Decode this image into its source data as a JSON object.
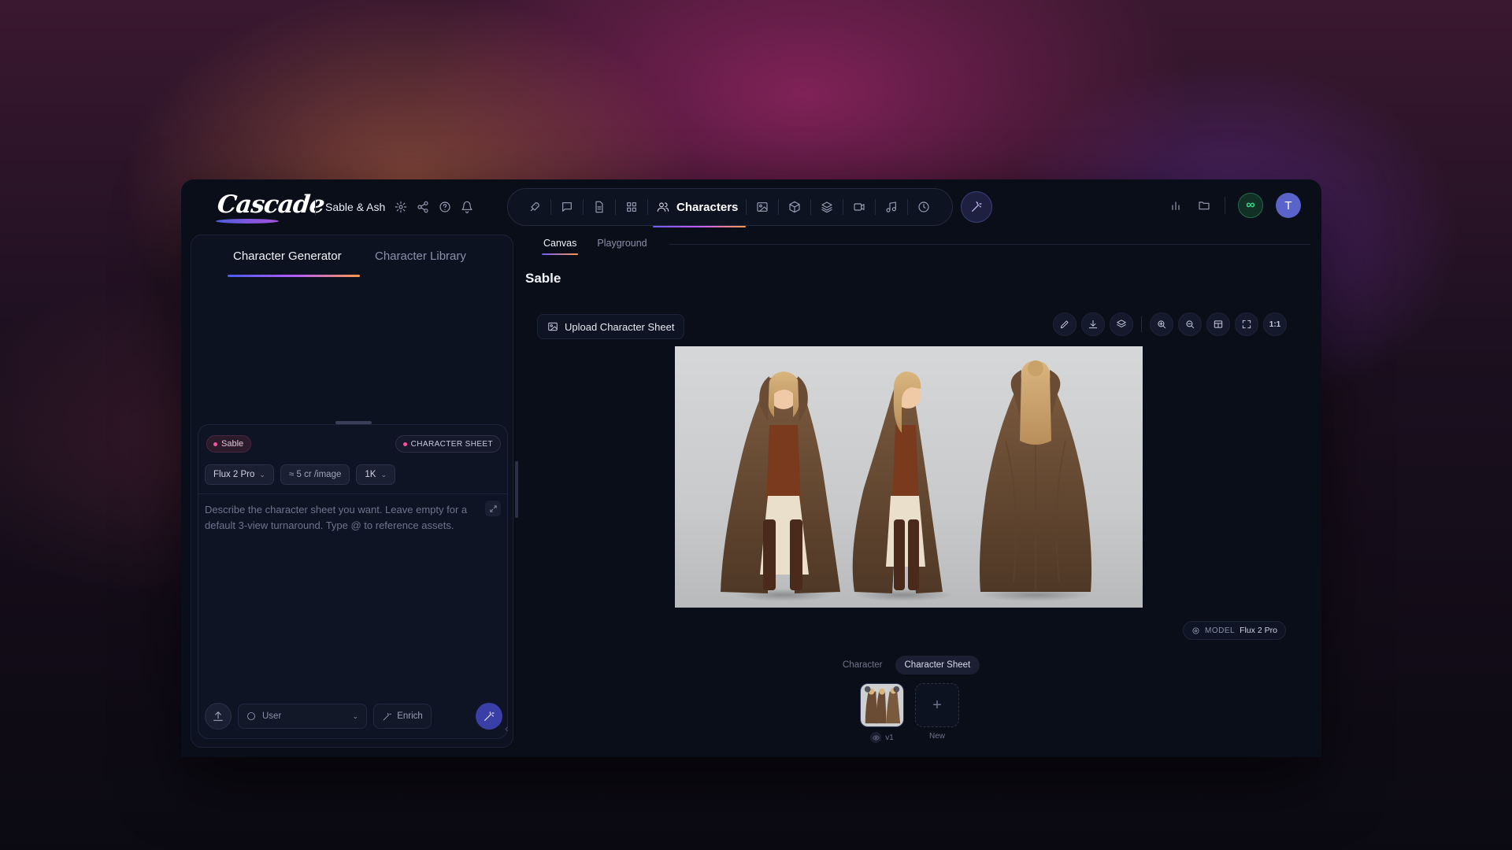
{
  "app": {
    "logo_text": "Cascade",
    "project_name": "Sable & Ash"
  },
  "nav": {
    "active_label": "Characters",
    "icons": [
      "rocket-icon",
      "chat-icon",
      "document-icon",
      "grid-icon",
      "characters-icon",
      "image-icon",
      "cube-icon",
      "layers-icon",
      "video-icon",
      "music-icon",
      "clock-icon"
    ]
  },
  "user": {
    "avatar_initial": "T",
    "credits_symbol": "∞"
  },
  "left_panel": {
    "tabs": [
      "Character Generator",
      "Character Library"
    ],
    "active_tab": "Character Generator",
    "chip_character": "Sable",
    "chip_mode": "CHARACTER SHEET",
    "model_select": "Flux 2 Pro",
    "cost": "≈ 5 cr /image",
    "resolution": "1K",
    "prompt_placeholder": "Describe the character sheet you want. Leave empty for a default 3-view turnaround. Type @ to reference assets.",
    "user_select": "User",
    "enrich_label": "Enrich"
  },
  "main": {
    "tabs": [
      "Canvas",
      "Playground"
    ],
    "active_tab": "Canvas",
    "title": "Sable",
    "upload_label": "Upload Character Sheet",
    "zoom_reset_label": "1:1",
    "model_label": "MODEL",
    "model_value": "Flux 2 Pro",
    "view_toggle": [
      "Character",
      "Character Sheet"
    ],
    "active_view": "Character Sheet",
    "versions": [
      {
        "label": "v1"
      }
    ],
    "new_label": "New"
  },
  "colors": {
    "accent": "#6b5cff",
    "background": "#0a0e19",
    "panel": "#0d1221"
  }
}
